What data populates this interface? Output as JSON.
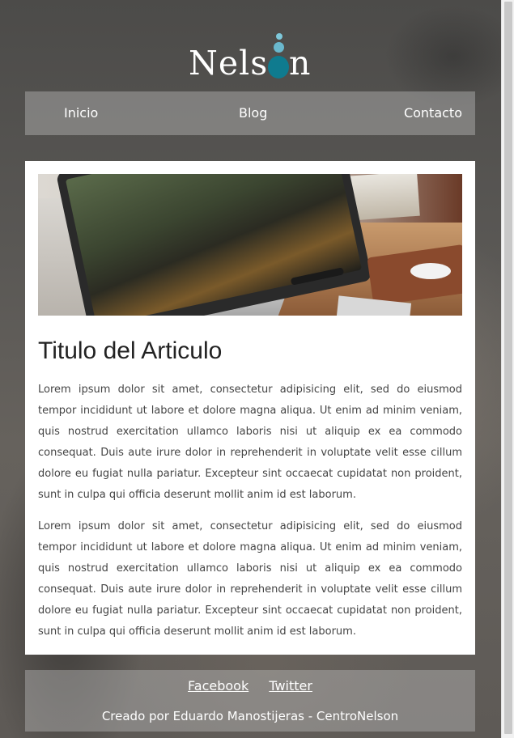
{
  "brand": {
    "name": "Nelson"
  },
  "nav": {
    "items": [
      "Inicio",
      "Blog",
      "Contacto"
    ]
  },
  "article": {
    "image_alt": "Escritorio con computadora",
    "title": "Titulo del Articulo",
    "paragraphs": [
      "Lorem ipsum dolor sit amet, consectetur adipisicing elit, sed do eiusmod tempor incididunt ut labore et dolore magna aliqua. Ut enim ad minim veniam, quis nostrud exercitation ullamco laboris nisi ut aliquip ex ea commodo consequat. Duis aute irure dolor in reprehenderit in voluptate velit esse cillum dolore eu fugiat nulla pariatur. Excepteur sint occaecat cupidatat non proident, sunt in culpa qui officia deserunt mollit anim id est laborum.",
      "Lorem ipsum dolor sit amet, consectetur adipisicing elit, sed do eiusmod tempor incididunt ut labore et dolore magna aliqua. Ut enim ad minim veniam, quis nostrud exercitation ullamco laboris nisi ut aliquip ex ea commodo consequat. Duis aute irure dolor in reprehenderit in voluptate velit esse cillum dolore eu fugiat nulla pariatur. Excepteur sint occaecat cupidatat non proident, sunt in culpa qui officia deserunt mollit anim id est laborum."
    ]
  },
  "footer": {
    "links": [
      "Facebook",
      "Twitter"
    ],
    "credit": "Creado por Eduardo Manostijeras - CentroNelson"
  },
  "colors": {
    "accent": "#0f7b8f",
    "accent_light": "#7ec8da"
  }
}
